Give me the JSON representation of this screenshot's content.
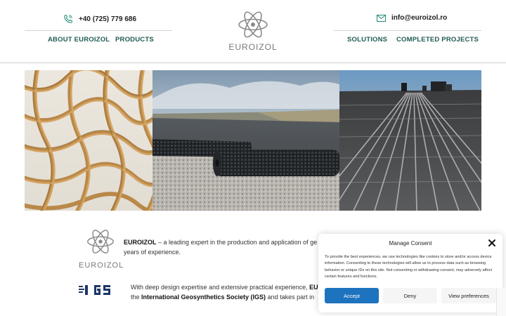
{
  "header": {
    "phone": "+40 (725) 779 686",
    "email": "info@euroizol.ro",
    "logo_text": "EUROIZOL",
    "nav": {
      "about": "ABOUT EUROIZOL",
      "products": "PRODUCTS",
      "solutions": "SOLUTIONS",
      "projects": "COMPLETED PROJECTS"
    }
  },
  "intro": {
    "logo_text": "EUROIZOL",
    "brand": "EUROIZOL",
    "text_rest": " – a leading expert in the production and application of ge",
    "line2": "years of experience."
  },
  "igs": {
    "line1_prefix": "With deep design expertise and extensive practical experience, ",
    "line1_bold": "EU",
    "line2_prefix": "the ",
    "line2_bold": "International Geosynthetics Society (IGS)",
    "line2_rest": " and takes part in"
  },
  "consent": {
    "title": "Manage Consent",
    "body": "To provide the best experiences, we use technologies like cookies to store and/or access device information. Consenting to these technologies will allow us to process data such as browsing behavior or unique IDs on this site. Not consenting or withdrawing consent, may adversely affect certain features and functions.",
    "accept": "Accept",
    "deny": "Deny",
    "prefs": "View preferences"
  },
  "colors": {
    "nav": "#1f5b52",
    "accept": "#1e73be",
    "logo_gray": "#777777"
  }
}
